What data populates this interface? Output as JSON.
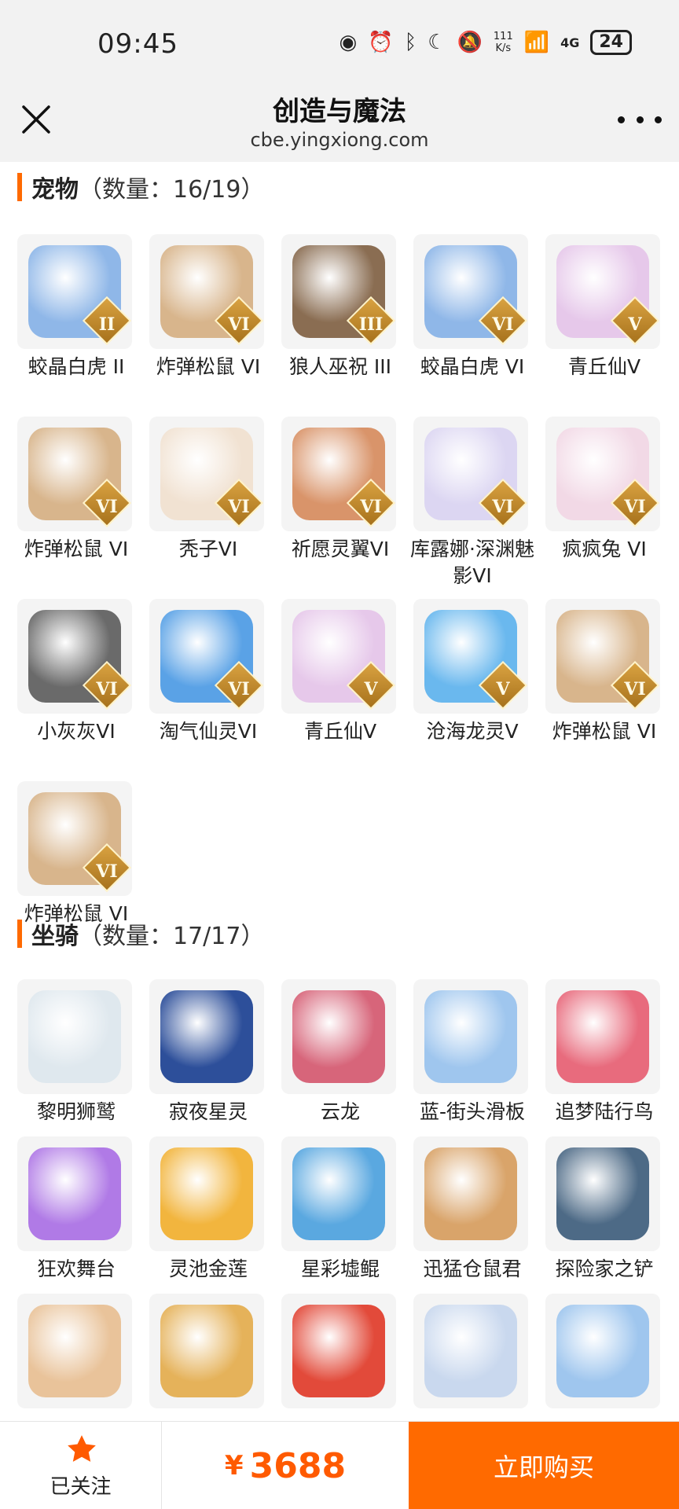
{
  "status": {
    "time": "09:45",
    "speed_top": "111",
    "speed_bottom": "K/s",
    "network": "4G",
    "battery": "24"
  },
  "header": {
    "title": "创造与魔法",
    "url": "cbe.yingxiong.com"
  },
  "pets": {
    "title": "宠物",
    "count": "（数量：16/19）",
    "items": [
      {
        "name": "蛟晶白虎 II",
        "badge": "II",
        "color": "#8fb7e8"
      },
      {
        "name": "炸弹松鼠 VI",
        "badge": "VI",
        "color": "#d8b58c"
      },
      {
        "name": "狼人巫祝 III",
        "badge": "III",
        "color": "#8a6d52"
      },
      {
        "name": "蛟晶白虎 VI",
        "badge": "VI",
        "color": "#8fb7e8"
      },
      {
        "name": "青丘仙V",
        "badge": "V",
        "color": "#e6c8ea"
      },
      {
        "name": "炸弹松鼠 VI",
        "badge": "VI",
        "color": "#d8b58c"
      },
      {
        "name": "秃子VI",
        "badge": "VI",
        "color": "#f1e2d2"
      },
      {
        "name": "祈愿灵翼VI",
        "badge": "VI",
        "color": "#d9946a"
      },
      {
        "name": "库露娜·深渊魅影VI",
        "badge": "VI",
        "color": "#dcd6f2"
      },
      {
        "name": "疯疯兔 VI",
        "badge": "VI",
        "color": "#f2d9e6"
      },
      {
        "name": "小灰灰VI",
        "badge": "VI",
        "color": "#6a6a6a"
      },
      {
        "name": "淘气仙灵VI",
        "badge": "VI",
        "color": "#5aa2e6"
      },
      {
        "name": "青丘仙V",
        "badge": "V",
        "color": "#e6c8ea"
      },
      {
        "name": "沧海龙灵V",
        "badge": "V",
        "color": "#6ab8ee"
      },
      {
        "name": "炸弹松鼠 VI",
        "badge": "VI",
        "color": "#d8b58c"
      },
      {
        "name": "炸弹松鼠 VI",
        "badge": "VI",
        "color": "#d8b58c"
      }
    ]
  },
  "mounts": {
    "title": "坐骑",
    "count": "（数量：17/17）",
    "items": [
      {
        "name": "黎明狮鹫",
        "color": "#dfe8ee"
      },
      {
        "name": "寂夜星灵",
        "color": "#2d4f9a"
      },
      {
        "name": "云龙",
        "color": "#d7657a"
      },
      {
        "name": "蓝-街头滑板",
        "color": "#9fc6ee"
      },
      {
        "name": "追梦陆行鸟",
        "color": "#e86b7d"
      },
      {
        "name": "狂欢舞台",
        "color": "#b07ae6"
      },
      {
        "name": "灵池金莲",
        "color": "#f2b53e"
      },
      {
        "name": "星彩墟鲲",
        "color": "#5aa8e0"
      },
      {
        "name": "迅猛仓鼠君",
        "color": "#d9a46a"
      },
      {
        "name": "探险家之铲",
        "color": "#4d6a86"
      },
      {
        "name": "",
        "color": "#e9c39a"
      },
      {
        "name": "",
        "color": "#e5b25a"
      },
      {
        "name": "",
        "color": "#e24a3a"
      },
      {
        "name": "",
        "color": "#c9d8ee"
      },
      {
        "name": "",
        "color": "#9fc6ee"
      }
    ]
  },
  "bottom": {
    "follow_label": "已关注",
    "price_symbol": "¥",
    "price": "3688",
    "buy_label": "立即购买"
  }
}
